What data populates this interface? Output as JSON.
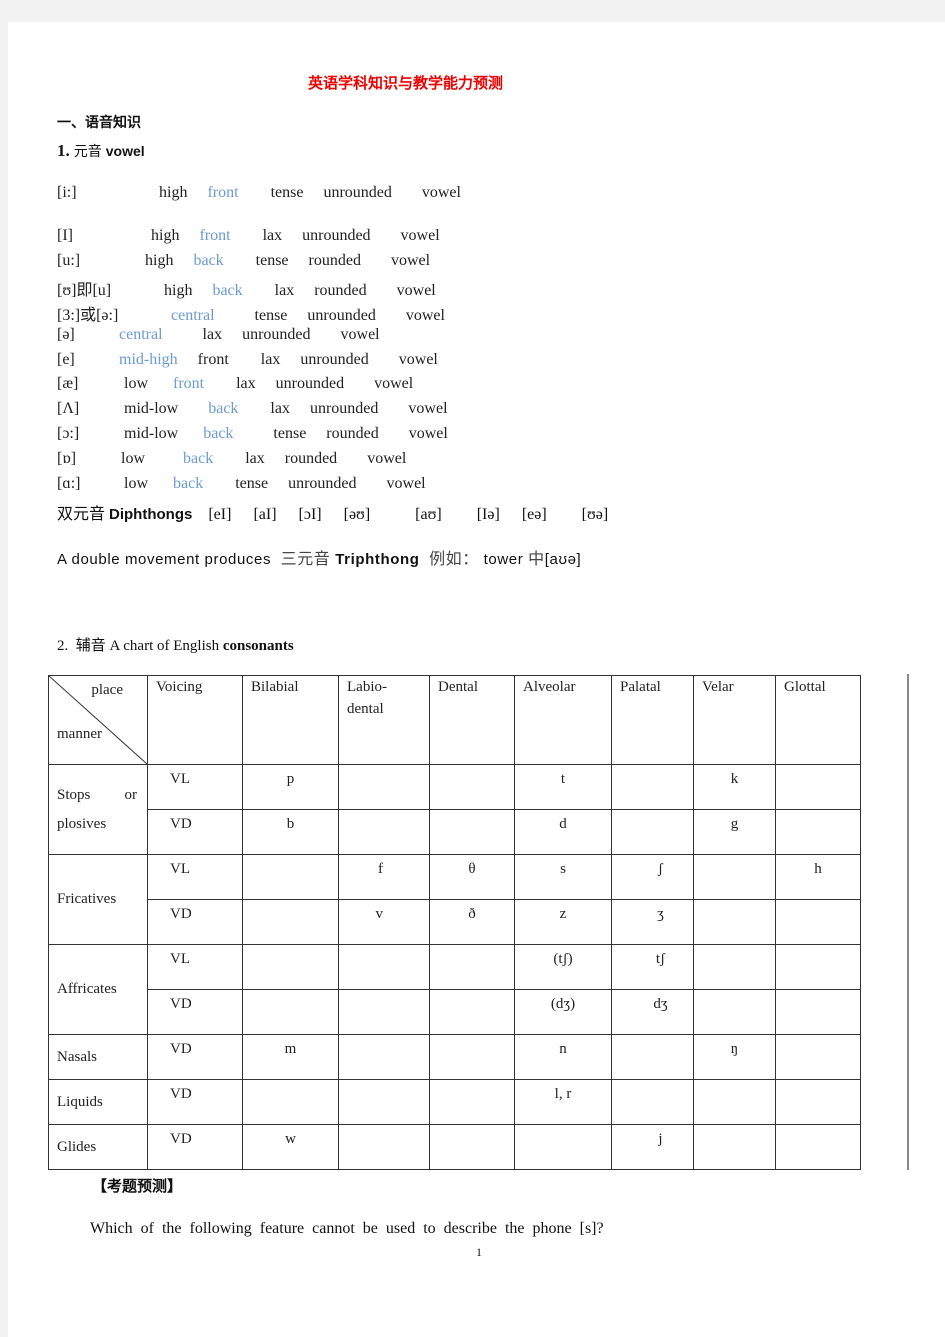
{
  "doc_title": "英语学科知识与教学能力预测",
  "section1": {
    "heading": "一、语音知识",
    "sub_num": "1.",
    "sub_cn": "元音",
    "sub_en": "vowel"
  },
  "colors": {
    "highlight": "#6c9bd2",
    "title": "#ee0000"
  },
  "vowels": [
    {
      "symbol": "[i:]",
      "features": [
        {
          "t": "high"
        },
        {
          "t": "front",
          "hl": true
        },
        {
          "t": "tense"
        },
        {
          "t": "unrounded"
        },
        {
          "t": "vowel"
        }
      ]
    },
    {
      "symbol": "[I]",
      "features": [
        {
          "t": "high"
        },
        {
          "t": "front",
          "hl": true
        },
        {
          "t": "lax"
        },
        {
          "t": "unrounded"
        },
        {
          "t": "vowel"
        }
      ]
    },
    {
      "symbol": "[u:]",
      "features": [
        {
          "t": "high"
        },
        {
          "t": "back",
          "hl": true
        },
        {
          "t": "tense"
        },
        {
          "t": "rounded"
        },
        {
          "t": "vowel"
        }
      ]
    },
    {
      "symbol": "[ʊ]即[u]",
      "features": [
        {
          "t": "high"
        },
        {
          "t": "back",
          "hl": true
        },
        {
          "t": "lax"
        },
        {
          "t": "rounded"
        },
        {
          "t": "vowel"
        }
      ]
    },
    {
      "symbol": "[3:]或[ə:]",
      "features": [
        {
          "t": "central",
          "hl": true
        },
        {
          "t": "tense"
        },
        {
          "t": "unrounded"
        },
        {
          "t": "vowel"
        }
      ]
    },
    {
      "symbol": "[ə]",
      "features": [
        {
          "t": "central",
          "hl": true
        },
        {
          "t": "lax"
        },
        {
          "t": "unrounded"
        },
        {
          "t": "vowel"
        }
      ]
    },
    {
      "symbol": "[e]",
      "features": [
        {
          "t": "mid-high",
          "hl": true
        },
        {
          "t": "front"
        },
        {
          "t": "lax"
        },
        {
          "t": "unrounded"
        },
        {
          "t": "vowel"
        }
      ]
    },
    {
      "symbol": "[æ]",
      "features": [
        {
          "t": "low"
        },
        {
          "t": "front",
          "hl": true
        },
        {
          "t": "lax"
        },
        {
          "t": "unrounded"
        },
        {
          "t": "vowel"
        }
      ]
    },
    {
      "symbol": "[Λ]",
      "features": [
        {
          "t": "mid-low"
        },
        {
          "t": "back",
          "hl": true
        },
        {
          "t": "lax"
        },
        {
          "t": "unrounded"
        },
        {
          "t": "vowel"
        }
      ]
    },
    {
      "symbol": "[ɔ:]",
      "features": [
        {
          "t": "mid-low"
        },
        {
          "t": "back",
          "hl": true
        },
        {
          "t": "tense"
        },
        {
          "t": "rounded"
        },
        {
          "t": "vowel"
        }
      ]
    },
    {
      "symbol": "[ɒ]",
      "features": [
        {
          "t": "low"
        },
        {
          "t": "back",
          "hl": true
        },
        {
          "t": "lax"
        },
        {
          "t": "rounded"
        },
        {
          "t": "vowel"
        }
      ]
    },
    {
      "symbol": "[ɑ:]",
      "features": [
        {
          "t": "low"
        },
        {
          "t": "back",
          "hl": true
        },
        {
          "t": "tense"
        },
        {
          "t": "unrounded"
        },
        {
          "t": "vowel"
        }
      ]
    }
  ],
  "diphthongs": {
    "label_cn": "双元音",
    "label_en": "Diphthongs",
    "items": [
      "[eI]",
      "[aI]",
      "[ɔI]",
      "[əʊ]",
      "[aʊ]",
      "[Iə]",
      "[eə]",
      "[ʊə]"
    ]
  },
  "triphthong": {
    "lead": "A double movement produces",
    "label_cn": "三元音",
    "label_en": "Triphthong",
    "example_cn": "例如：",
    "example_word": "tower",
    "example_in": "中",
    "example_ipa": "[aʊə]"
  },
  "section2": {
    "num": "2.",
    "cn": "辅音",
    "text": "A chart of English",
    "bold": "consonants"
  },
  "consonant_table": {
    "corner_place": "place",
    "corner_manner": "manner",
    "headers": [
      "Voicing",
      "Bilabial",
      "Labio-\ndental",
      "Dental",
      "Alveolar",
      "Palatal",
      "Velar",
      "Glottal"
    ],
    "groups": [
      {
        "manner": "Stops or plosives",
        "rows": [
          {
            "voicing": "VL",
            "cells": [
              "p",
              "",
              "",
              "t",
              "",
              "k",
              ""
            ]
          },
          {
            "voicing": "VD",
            "cells": [
              "b",
              "",
              "",
              "d",
              "",
              "g",
              ""
            ]
          }
        ]
      },
      {
        "manner": "Fricatives",
        "rows": [
          {
            "voicing": "VL",
            "cells": [
              "",
              "f",
              "θ",
              "s",
              "ʃ",
              "",
              "h"
            ]
          },
          {
            "voicing": "VD",
            "cells": [
              "",
              "v",
              "ð",
              "z",
              "ʒ",
              "",
              ""
            ]
          }
        ]
      },
      {
        "manner": "Affricates",
        "rows": [
          {
            "voicing": "VL",
            "cells": [
              "",
              "",
              "",
              "(tʃ)",
              "tʃ",
              "",
              ""
            ]
          },
          {
            "voicing": "VD",
            "cells": [
              "",
              "",
              "",
              "(dʒ)",
              "dʒ",
              "",
              ""
            ]
          }
        ]
      },
      {
        "manner": "Nasals",
        "rows": [
          {
            "voicing": "VD",
            "cells": [
              "m",
              "",
              "",
              "n",
              "",
              "ŋ",
              ""
            ]
          }
        ]
      },
      {
        "manner": "Liquids",
        "rows": [
          {
            "voicing": "VD",
            "cells": [
              "",
              "",
              "",
              "l, r",
              "",
              "",
              ""
            ]
          }
        ]
      },
      {
        "manner": "Glides",
        "rows": [
          {
            "voicing": "VD",
            "cells": [
              "w",
              "",
              "",
              "",
              "j",
              "",
              ""
            ]
          }
        ]
      }
    ]
  },
  "exam": {
    "heading": "【考题预测】",
    "question": "Which of the following feature cannot be used to describe the phone [s]?"
  },
  "page_number": "1"
}
